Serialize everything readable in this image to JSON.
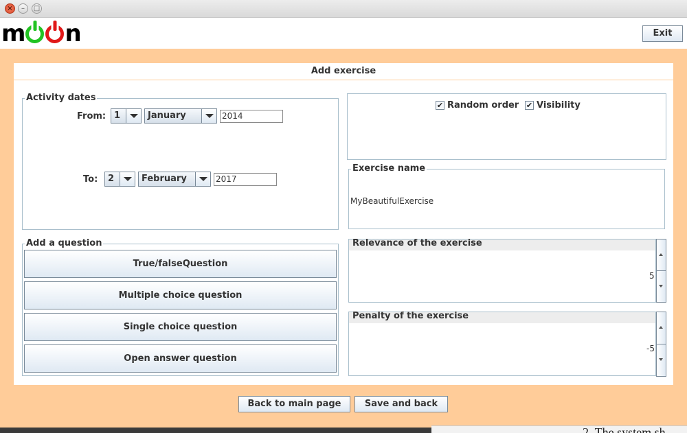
{
  "window": {
    "controls": [
      "close-icon",
      "minimize-icon",
      "maximize-icon"
    ]
  },
  "header": {
    "logo_text": "moon",
    "exit_label": "Exit"
  },
  "page_title": "Add exercise",
  "activity_dates": {
    "legend": "Activity dates",
    "from": {
      "label": "From:",
      "day": "1",
      "month": "January",
      "year": "2014"
    },
    "to": {
      "label": "To:",
      "day": "2",
      "month": "February",
      "year": "2017"
    }
  },
  "options": {
    "random_order": {
      "label": "Random order",
      "checked": true
    },
    "visibility": {
      "label": "Visibility",
      "checked": true
    }
  },
  "exercise_name": {
    "legend": "Exercise name",
    "value": "MyBeautifulExercise"
  },
  "add_question": {
    "legend": "Add a question",
    "buttons": [
      "True/falseQuestion",
      "Multiple choice question",
      "Single choice question",
      "Open answer question"
    ]
  },
  "relevance": {
    "legend": "Relevance of the exercise",
    "value": "5"
  },
  "penalty": {
    "legend": "Penalty of the exercise",
    "value": "-5"
  },
  "footer": {
    "back_label": "Back to main page",
    "save_label": "Save and back"
  },
  "background_snippet": "2. The system sh",
  "colors": {
    "frame_bg": "#ffcc99",
    "button_top": "#ffffff",
    "button_bottom": "#dfe9f3",
    "border": "#a9bfcc",
    "logo_green": "#22c322",
    "logo_red": "#e01818"
  }
}
